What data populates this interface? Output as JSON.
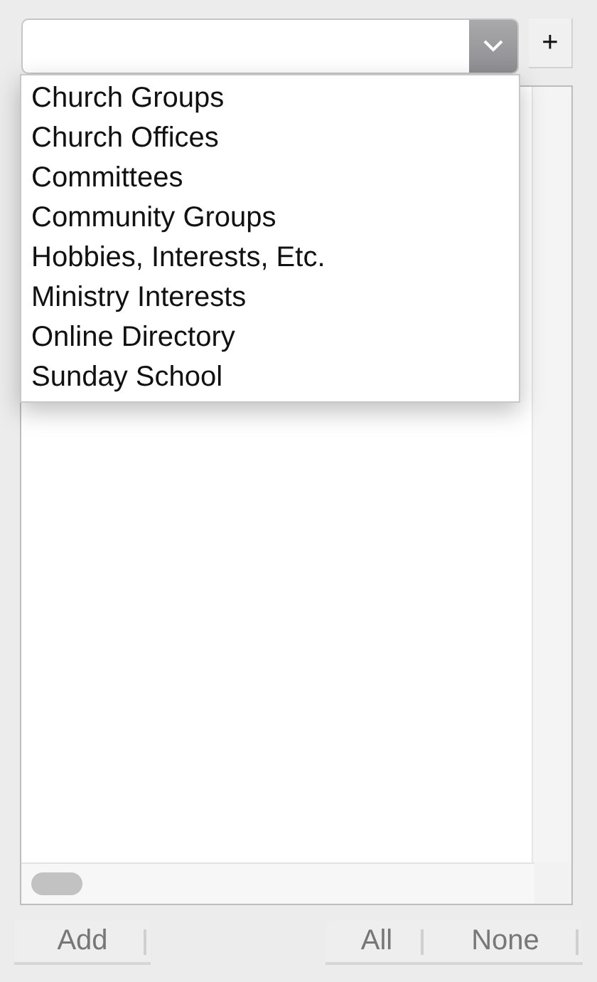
{
  "combo_box": {
    "expanded": true,
    "options": [
      "Church Groups",
      "Church Offices",
      "Committees",
      "Community Groups",
      "Hobbies, Interests, Etc.",
      "Ministry Interests",
      "Online Directory",
      "Sunday School"
    ]
  },
  "plus_button": "+",
  "footer_buttons": [
    "Add",
    "All",
    "None"
  ]
}
